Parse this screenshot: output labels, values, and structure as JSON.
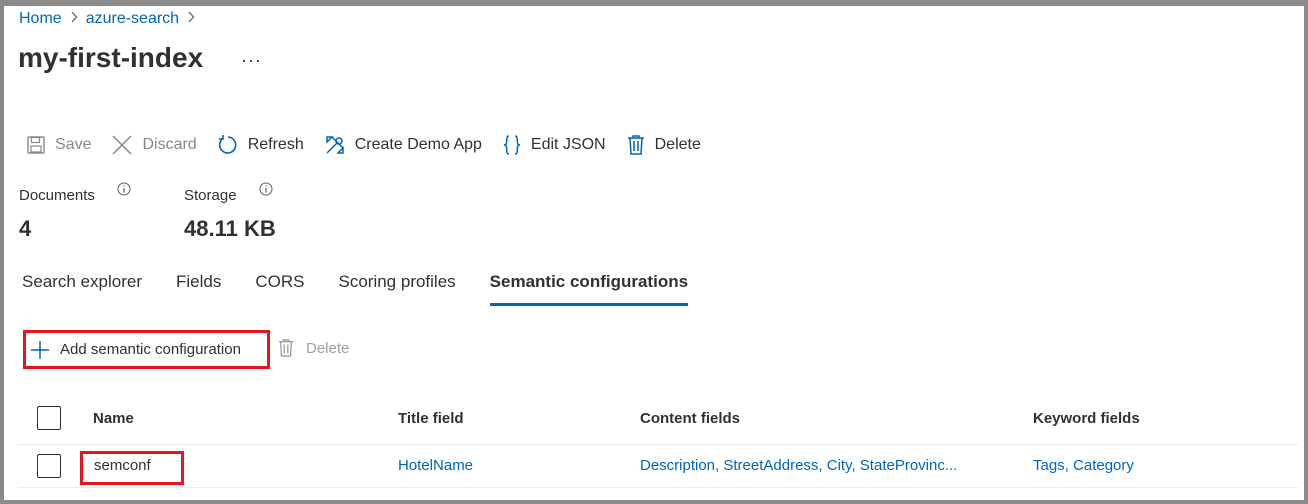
{
  "breadcrumb": {
    "items": [
      "Home",
      "azure-search"
    ]
  },
  "page": {
    "title": "my-first-index",
    "more_label": "···"
  },
  "toolbar": {
    "save": "Save",
    "discard": "Discard",
    "refresh": "Refresh",
    "create_demo_app": "Create Demo App",
    "edit_json": "Edit JSON",
    "delete": "Delete"
  },
  "stats": {
    "documents_label": "Documents",
    "documents_value": "4",
    "storage_label": "Storage",
    "storage_value": "48.11 KB"
  },
  "tabs": [
    {
      "label": "Search explorer",
      "active": false
    },
    {
      "label": "Fields",
      "active": false
    },
    {
      "label": "CORS",
      "active": false
    },
    {
      "label": "Scoring profiles",
      "active": false
    },
    {
      "label": "Semantic configurations",
      "active": true
    }
  ],
  "semantic_toolbar": {
    "add": "Add semantic configuration",
    "delete": "Delete"
  },
  "table": {
    "columns": [
      "Name",
      "Title field",
      "Content fields",
      "Keyword fields"
    ],
    "rows": [
      {
        "name": "semconf",
        "title_field": "HotelName",
        "content_fields": "Description, StreetAddress, City, StateProvinc...",
        "keyword_fields": "Tags, Category"
      }
    ]
  },
  "colors": {
    "link": "#0067b8",
    "highlight_border": "#e3151f",
    "disabled": "#8a8886"
  }
}
